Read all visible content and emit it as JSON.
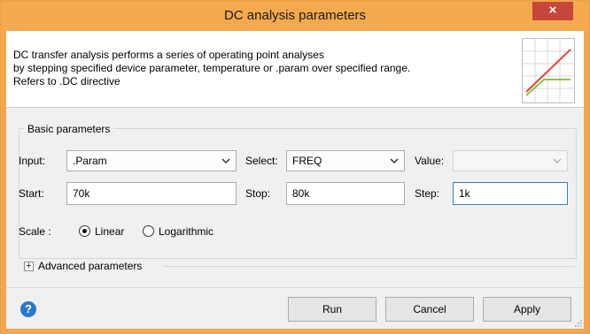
{
  "window": {
    "title": "DC analysis parameters",
    "close_glyph": "×",
    "accent_color": "#f5a94f"
  },
  "description": {
    "lines": [
      "DC transfer analysis performs a series of operating point analyses",
      "by stepping specified device parameter, temperature or .param over specified range.",
      "Refers to .DC directive"
    ],
    "icon": "dc-sweep-chart-icon"
  },
  "basic": {
    "group_label": "Basic parameters",
    "input_label": "Input:",
    "input_value": ".Param",
    "select_label": "Select:",
    "select_value": "FREQ",
    "value_label": "Value:",
    "value_value": "",
    "start_label": "Start:",
    "start_value": "70k",
    "stop_label": "Stop:",
    "stop_value": "80k",
    "step_label": "Step:",
    "step_value": "1k",
    "scale_label": "Scale :",
    "scale_options": [
      "Linear",
      "Logarithmic"
    ],
    "scale_selected": "Linear"
  },
  "advanced": {
    "expander_glyph": "+",
    "label": "Advanced parameters"
  },
  "buttons": {
    "help_glyph": "?",
    "run": "Run",
    "cancel": "Cancel",
    "apply": "Apply"
  }
}
